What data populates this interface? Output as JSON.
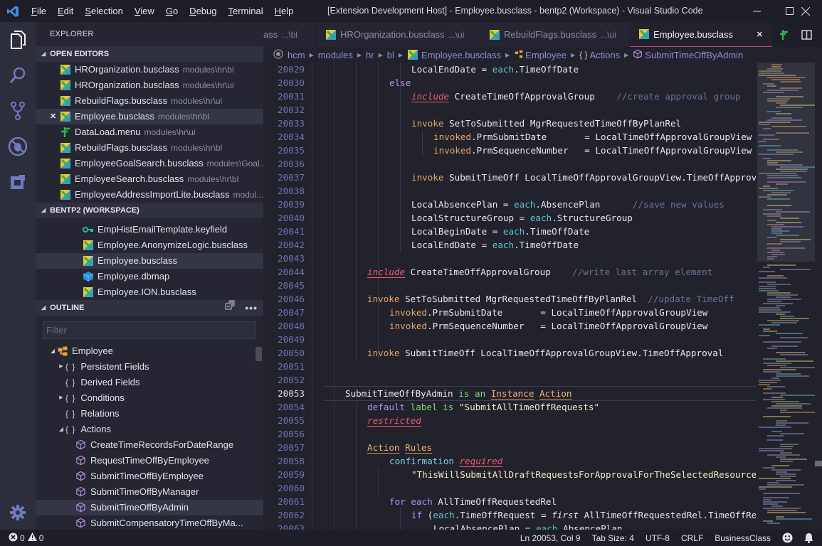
{
  "titlebar": {
    "menu": [
      {
        "u": "F",
        "rest": "ile"
      },
      {
        "u": "E",
        "rest": "dit"
      },
      {
        "u": "S",
        "rest": "election"
      },
      {
        "u": "V",
        "rest": "iew"
      },
      {
        "u": "G",
        "rest": "o"
      },
      {
        "u": "D",
        "rest": "ebug"
      },
      {
        "u": "T",
        "rest": "erminal"
      },
      {
        "u": "H",
        "rest": "elp"
      }
    ],
    "title": "[Extension Development Host] - Employee.busclass - bentp2 (Workspace) - Visual Studio Code",
    "controls": {
      "minimize": "—",
      "maximize": "☐",
      "close": "✕"
    }
  },
  "activitybar": [
    "explorer-icon",
    "search-icon",
    "source-control-icon",
    "debug-icon",
    "extensions-icon",
    "settings-gear-icon"
  ],
  "sidebar": {
    "title": "EXPLORER",
    "open_editors": {
      "header": "OPEN EDITORS",
      "items": [
        {
          "name": "HROrganization.busclass",
          "desc": "modules\\hr\\bl",
          "icon": "busclass"
        },
        {
          "name": "HROrganization.busclass",
          "desc": "modules\\hr\\ui",
          "icon": "busclass"
        },
        {
          "name": "RebuildFlags.busclass",
          "desc": "modules\\hr\\ui",
          "icon": "busclass"
        },
        {
          "name": "Employee.busclass",
          "desc": "modules\\hr\\bl",
          "icon": "busclass",
          "selected": true,
          "close": "✕"
        },
        {
          "name": "DataLoad.menu",
          "desc": "modules\\hr\\ui",
          "icon": "menu"
        },
        {
          "name": "RebuildFlags.busclass",
          "desc": "modules\\hr\\bl",
          "icon": "busclass"
        },
        {
          "name": "EmployeeGoalSearch.busclass",
          "desc": "modules\\Goal...",
          "icon": "busclass"
        },
        {
          "name": "EmployeeSearch.busclass",
          "desc": "modules\\hr\\bl",
          "icon": "busclass"
        },
        {
          "name": "EmployeeAddressImportLite.busclass",
          "desc": "modul...",
          "icon": "busclass"
        }
      ]
    },
    "workspace": {
      "header": "BENTP2 (WORKSPACE)",
      "items": [
        {
          "name": "EmpHistEmailTemplate.keyfield",
          "icon": "keyfield"
        },
        {
          "name": "Employee.AnonymizeLogic.busclass",
          "icon": "busclass"
        },
        {
          "name": "Employee.busclass",
          "icon": "busclass",
          "selected": true
        },
        {
          "name": "Employee.dbmap",
          "icon": "dbmap"
        },
        {
          "name": "Employee.ION.busclass",
          "icon": "busclass"
        }
      ]
    },
    "outline": {
      "header": "OUTLINE",
      "filter_placeholder": "Filter",
      "root": "Employee",
      "groups": [
        {
          "label": "Persistent Fields",
          "twisty": "collapsed"
        },
        {
          "label": "Derived Fields",
          "twisty": "none"
        },
        {
          "label": "Conditions",
          "twisty": "collapsed"
        },
        {
          "label": "Relations",
          "twisty": "none"
        },
        {
          "label": "Actions",
          "twisty": "expanded"
        }
      ],
      "actions": [
        {
          "label": "CreateTimeRecordsForDateRange"
        },
        {
          "label": "RequestTimeOffByEmployee"
        },
        {
          "label": "SubmitTimeOffByEmployee"
        },
        {
          "label": "SubmitTimeOffByManager"
        },
        {
          "label": "SubmitTimeOffByAdmin",
          "selected": true
        },
        {
          "label": "SubmitCompensatoryTimeOffByMa..."
        }
      ]
    }
  },
  "tabs": [
    {
      "name": "ass",
      "desc": "...\\bl",
      "partial": true
    },
    {
      "name": "HROrganization.busclass",
      "desc": "...\\ui"
    },
    {
      "name": "RebuildFlags.busclass",
      "desc": "...\\ui"
    },
    {
      "name": "Employee.busclass",
      "desc": "",
      "active": true,
      "close": "✕"
    }
  ],
  "breadcrumb": [
    "hcm",
    "modules",
    "hr",
    "bl",
    "Employee.busclass",
    "Employee",
    "Actions",
    "SubmitTimeOffByAdmin"
  ],
  "editor": {
    "current_line": 20053,
    "lines": [
      {
        "n": "20029",
        "indent": 4,
        "tokens": [
          [
            "",
            "LocalEndDate = "
          ],
          [
            "each",
            "each"
          ],
          [
            "",
            ".TimeOffDate"
          ]
        ]
      },
      {
        "n": "20030",
        "indent": 3,
        "tokens": [
          [
            "purple",
            "else"
          ]
        ]
      },
      {
        "n": "20031",
        "indent": 4,
        "tokens": [
          [
            "err",
            "include"
          ],
          [
            "",
            " CreateTimeOffApprovalGroup    "
          ],
          [
            "com",
            "//create approval group"
          ]
        ]
      },
      {
        "n": "20032",
        "indent": 4,
        "tokens": []
      },
      {
        "n": "20033",
        "indent": 4,
        "tokens": [
          [
            "kw",
            "invoke"
          ],
          [
            "",
            " SetToSubmitted MgrRequestedTimeOffByPlanRel"
          ]
        ]
      },
      {
        "n": "20034",
        "indent": 5,
        "tokens": [
          [
            "kw",
            "invoked"
          ],
          [
            "",
            ".PrmSubmitDate       = LocalTimeOffApprovalGroupView"
          ]
        ]
      },
      {
        "n": "20035",
        "indent": 5,
        "tokens": [
          [
            "kw",
            "invoked"
          ],
          [
            "",
            ".PrmSequenceNumber   = LocalTimeOffApprovalGroupView"
          ]
        ]
      },
      {
        "n": "20036",
        "indent": 4,
        "tokens": []
      },
      {
        "n": "20037",
        "indent": 4,
        "tokens": [
          [
            "kw",
            "invoke"
          ],
          [
            "",
            " SubmitTimeOff LocalTimeOffApprovalGroupView.TimeOffApproval"
          ]
        ]
      },
      {
        "n": "20038",
        "indent": 4,
        "tokens": []
      },
      {
        "n": "20039",
        "indent": 4,
        "tokens": [
          [
            "",
            "LocalAbsencePlan = "
          ],
          [
            "each",
            "each"
          ],
          [
            "",
            ".AbsencePlan      "
          ],
          [
            "com",
            "//save new values"
          ]
        ]
      },
      {
        "n": "20040",
        "indent": 4,
        "tokens": [
          [
            "",
            "LocalStructureGroup = "
          ],
          [
            "each",
            "each"
          ],
          [
            "",
            ".StructureGroup"
          ]
        ]
      },
      {
        "n": "20041",
        "indent": 4,
        "tokens": [
          [
            "",
            "LocalBeginDate = "
          ],
          [
            "each",
            "each"
          ],
          [
            "",
            ".TimeOffDate"
          ]
        ]
      },
      {
        "n": "20042",
        "indent": 4,
        "tokens": [
          [
            "",
            "LocalEndDate = "
          ],
          [
            "each",
            "each"
          ],
          [
            "",
            ".TimeOffDate"
          ]
        ]
      },
      {
        "n": "20043",
        "indent": 3,
        "tokens": []
      },
      {
        "n": "20044",
        "indent": 2,
        "tokens": [
          [
            "err",
            "include"
          ],
          [
            "",
            " CreateTimeOffApprovalGroup    "
          ],
          [
            "com",
            "//write last array element"
          ]
        ]
      },
      {
        "n": "20045",
        "indent": 2,
        "tokens": []
      },
      {
        "n": "20046",
        "indent": 2,
        "tokens": [
          [
            "kw",
            "invoke"
          ],
          [
            "",
            " SetToSubmitted MgrRequestedTimeOffByPlanRel  "
          ],
          [
            "com",
            "//update TimeOff"
          ]
        ]
      },
      {
        "n": "20047",
        "indent": 3,
        "tokens": [
          [
            "kw",
            "invoked"
          ],
          [
            "",
            ".PrmSubmitDate       = LocalTimeOffApprovalGroupView"
          ]
        ]
      },
      {
        "n": "20048",
        "indent": 3,
        "tokens": [
          [
            "kw",
            "invoked"
          ],
          [
            "",
            ".PrmSequenceNumber   = LocalTimeOffApprovalGroupView"
          ]
        ]
      },
      {
        "n": "20049",
        "indent": 2,
        "tokens": []
      },
      {
        "n": "20050",
        "indent": 2,
        "tokens": [
          [
            "kw",
            "invoke"
          ],
          [
            "",
            " SubmitTimeOff LocalTimeOffApprovalGroupView.TimeOffApproval"
          ]
        ]
      },
      {
        "n": "20051",
        "indent": 0,
        "tokens": []
      },
      {
        "n": "20052",
        "indent": 0,
        "tokens": []
      },
      {
        "n": "20053",
        "indent": 1,
        "tokens": [
          [
            "",
            "SubmitTimeOffByAdmin "
          ],
          [
            "green",
            "is an"
          ],
          [
            "",
            " "
          ],
          [
            "act",
            "Instance"
          ],
          [
            "",
            " "
          ],
          [
            "act",
            "Action"
          ]
        ]
      },
      {
        "n": "20054",
        "indent": 2,
        "tokens": [
          [
            "purple",
            "default"
          ],
          [
            "",
            " "
          ],
          [
            "green",
            "label is"
          ],
          [
            "",
            " "
          ],
          [
            "str",
            "\"SubmitAllTimeOffRequests\""
          ]
        ]
      },
      {
        "n": "20055",
        "indent": 2,
        "tokens": [
          [
            "err",
            "restricted"
          ]
        ]
      },
      {
        "n": "20056",
        "indent": 2,
        "tokens": []
      },
      {
        "n": "20057",
        "indent": 2,
        "tokens": [
          [
            "act",
            "Action"
          ],
          [
            "",
            " "
          ],
          [
            "act",
            "Rules"
          ]
        ]
      },
      {
        "n": "20058",
        "indent": 3,
        "tokens": [
          [
            "cyan",
            "confirmation"
          ],
          [
            "",
            " "
          ],
          [
            "err",
            "required"
          ]
        ]
      },
      {
        "n": "20059",
        "indent": 4,
        "tokens": [
          [
            "str",
            "\"ThisWillSubmitAllDraftRequestsForApprovalForTheSelectedResource\""
          ]
        ]
      },
      {
        "n": "20060",
        "indent": 3,
        "tokens": []
      },
      {
        "n": "20061",
        "indent": 3,
        "tokens": [
          [
            "purple",
            "for"
          ],
          [
            "",
            " "
          ],
          [
            "purple",
            "each"
          ],
          [
            "",
            " AllTimeOffRequestedRel"
          ]
        ]
      },
      {
        "n": "20062",
        "indent": 4,
        "tokens": [
          [
            "purple",
            "if"
          ],
          [
            "",
            " ("
          ],
          [
            "each",
            "each"
          ],
          [
            "",
            ".TimeOffRequest = "
          ],
          [
            "it",
            "first"
          ],
          [
            "",
            " AllTimeOffRequestedRel.TimeOffRequest)"
          ]
        ]
      },
      {
        "n": "20063",
        "indent": 5,
        "tokens": [
          [
            "",
            "LocalAbsencePlan = "
          ],
          [
            "each",
            "each"
          ],
          [
            "",
            ".AbsencePlan"
          ]
        ]
      }
    ]
  },
  "statusbar": {
    "errors": "0",
    "warnings": "0",
    "position": "Ln 20053, Col 9",
    "tab_size": "Tab Size: 4",
    "encoding": "UTF-8",
    "eol": "CRLF",
    "language": "BusinessClass"
  },
  "colors": {
    "accent_tab_border": "#b84a90",
    "background": "#21222c",
    "sidebar": "#252632",
    "keyword": "#e6a56b",
    "error": "#ef5a6f"
  }
}
